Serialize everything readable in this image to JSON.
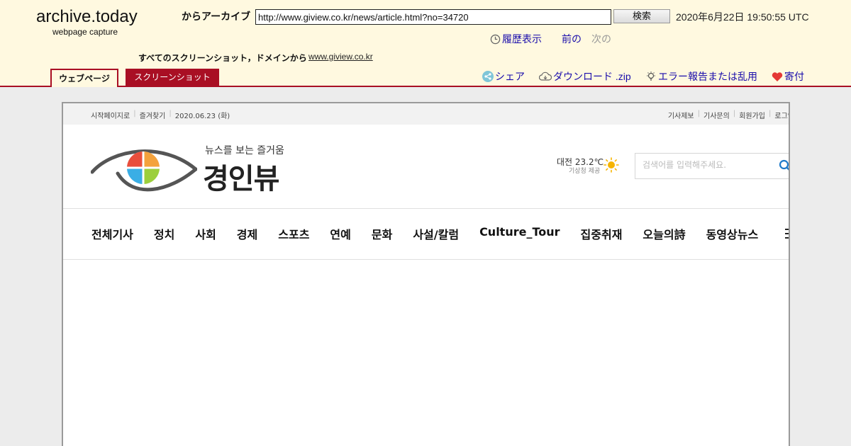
{
  "archive": {
    "logo": "archive.today",
    "subtitle": "webpage capture",
    "from_label": "からアーカイブ",
    "url_value": "http://www.giview.co.kr/news/article.html?no=34720",
    "search_label": "検索",
    "capture_date": "2020年6月22日 19:50:55 UTC",
    "history_label": "履歴表示",
    "prev_label": "前の",
    "next_label": "次の",
    "all_screenshots_label": "すべてのスクリーンショット，ドメインから",
    "domain_link": "www.giview.co.kr",
    "tab_webpage": "ウェブページ",
    "tab_screenshot": "スクリーンショット",
    "share_label": "シェア",
    "download_label": "ダウンロード .zip",
    "report_label": "エラー報告または乱用",
    "donate_label": "寄付",
    "colors": {
      "accent": "#a90f24",
      "header_bg": "#fff9e0",
      "link": "#1a0dab"
    }
  },
  "site": {
    "topbar_left": [
      "시작페이지로",
      "즐겨찾기",
      "2020.06.23 (화)"
    ],
    "topbar_right": [
      "기사제보",
      "기사문의",
      "회원가입",
      "로그인"
    ],
    "tagline": "뉴스를 보는 즐거움",
    "name": "경인뷰",
    "weather_text": "대전 23.2℃",
    "weather_source": "기상청 제공",
    "search_placeholder": "검색어를 입력해주세요.",
    "nav": [
      "전체기사",
      "정치",
      "사회",
      "경제",
      "스포츠",
      "연예",
      "문화",
      "사설/칼럼",
      "Culture_Tour",
      "집중취재",
      "오늘의詩",
      "동영상뉴스"
    ],
    "icons": [
      "logo-eye-icon",
      "sun-icon",
      "search-icon",
      "menu-icon"
    ]
  }
}
